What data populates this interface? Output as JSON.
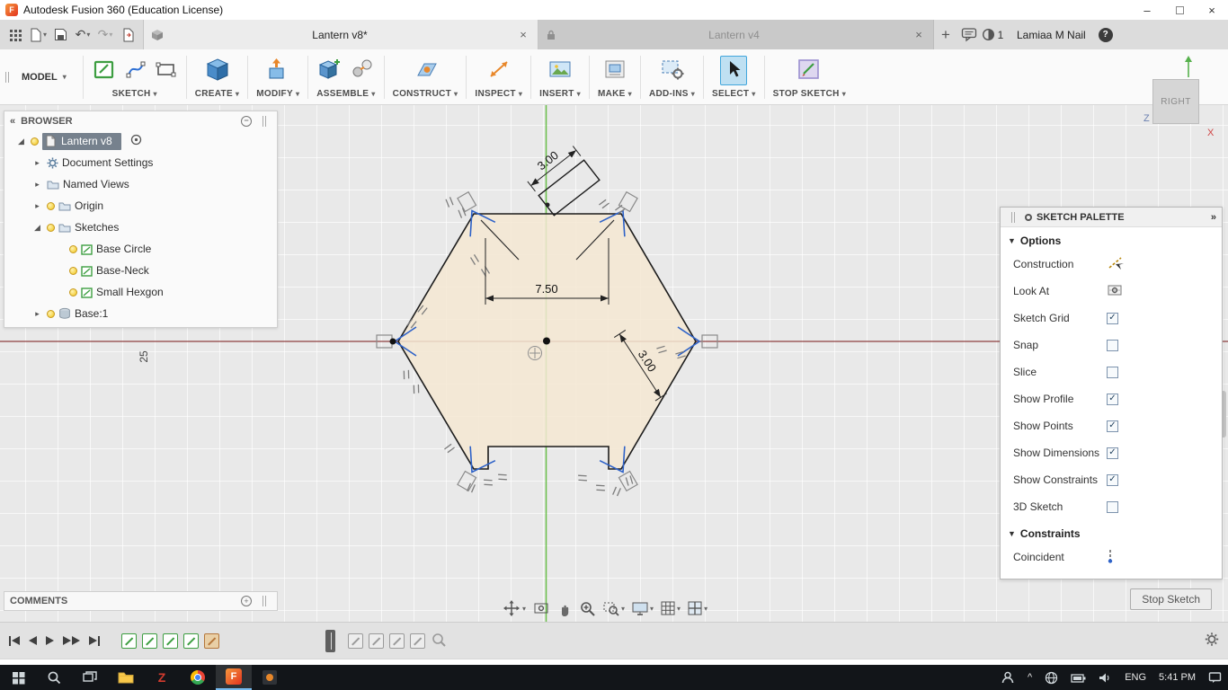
{
  "title_bar": {
    "title": "Autodesk Fusion 360 (Education License)"
  },
  "tabs": {
    "active": "Lantern v8*",
    "inactive": "Lantern v4",
    "notification_count": "1",
    "user_name": "Lamiaa M Nail"
  },
  "ribbon": {
    "workspace": "MODEL",
    "groups": [
      {
        "label": "SKETCH"
      },
      {
        "label": "CREATE"
      },
      {
        "label": "MODIFY"
      },
      {
        "label": "ASSEMBLE"
      },
      {
        "label": "CONSTRUCT"
      },
      {
        "label": "INSPECT"
      },
      {
        "label": "INSERT"
      },
      {
        "label": "MAKE"
      },
      {
        "label": "ADD-INS"
      },
      {
        "label": "SELECT"
      },
      {
        "label": "STOP SKETCH"
      }
    ]
  },
  "browser": {
    "header": "BROWSER",
    "items": [
      {
        "label": "Lantern v8"
      },
      {
        "label": "Document Settings"
      },
      {
        "label": "Named Views"
      },
      {
        "label": "Origin"
      },
      {
        "label": "Sketches"
      },
      {
        "label": "Base Circle"
      },
      {
        "label": "Base-Neck"
      },
      {
        "label": "Small Hexgon"
      },
      {
        "label": "Base:1"
      }
    ]
  },
  "canvas": {
    "dimensions": {
      "neck": "3.00",
      "width": "7.50",
      "corner": "3.00",
      "left": "25"
    },
    "viewcube": {
      "face": "RIGHT",
      "axis_z": "Z",
      "axis_x": "X"
    }
  },
  "palette": {
    "header": "SKETCH PALETTE",
    "options_section": "Options",
    "options": [
      {
        "label": "Construction"
      },
      {
        "label": "Look At"
      },
      {
        "label": "Sketch Grid",
        "checked": true
      },
      {
        "label": "Snap",
        "checked": false
      },
      {
        "label": "Slice",
        "checked": false
      },
      {
        "label": "Show Profile",
        "checked": true
      },
      {
        "label": "Show Points",
        "checked": true
      },
      {
        "label": "Show Dimensions",
        "checked": true
      },
      {
        "label": "Show Constraints",
        "checked": true
      },
      {
        "label": "3D Sketch",
        "checked": false
      }
    ],
    "constraints_section": "Constraints",
    "constraints": [
      {
        "label": "Coincident"
      }
    ],
    "stop_sketch": "Stop Sketch"
  },
  "comments": {
    "header": "COMMENTS"
  },
  "taskbar": {
    "language": "ENG",
    "time": "5:41 PM"
  }
}
